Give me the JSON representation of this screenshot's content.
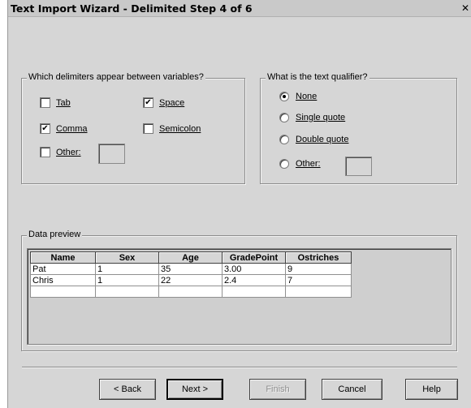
{
  "window": {
    "title": "Text Import Wizard - Delimited Step 4 of 6",
    "close_glyph": "✕"
  },
  "delimiters": {
    "label": "Which delimiters appear between variables?",
    "tab": {
      "label": "Tab",
      "checked": false
    },
    "space": {
      "label": "Space",
      "checked": true
    },
    "comma": {
      "label": "Comma",
      "checked": true
    },
    "semicolon": {
      "label": "Semicolon",
      "checked": false
    },
    "other": {
      "label": "Other:",
      "checked": false,
      "value": ""
    }
  },
  "qualifier": {
    "label": "What is the text qualifier?",
    "selected": "none",
    "options": {
      "none": "None",
      "single": "Single quote",
      "double": "Double quote",
      "other": "Other:"
    },
    "other_value": ""
  },
  "preview": {
    "label": "Data preview",
    "columns": [
      "Name",
      "Sex",
      "Age",
      "GradePoint",
      "Ostriches"
    ],
    "rows": [
      [
        "Pat",
        "1",
        "35",
        "3.00",
        "9"
      ],
      [
        "Chris",
        "1",
        "22",
        "2.4",
        "7"
      ],
      [
        "",
        "",
        "",
        "",
        ""
      ]
    ]
  },
  "buttons": {
    "back": "< Back",
    "next": "Next >",
    "finish": "Finish",
    "cancel": "Cancel",
    "help": "Help"
  },
  "icons": {
    "checkmark": "✔",
    "close": "close-x"
  }
}
